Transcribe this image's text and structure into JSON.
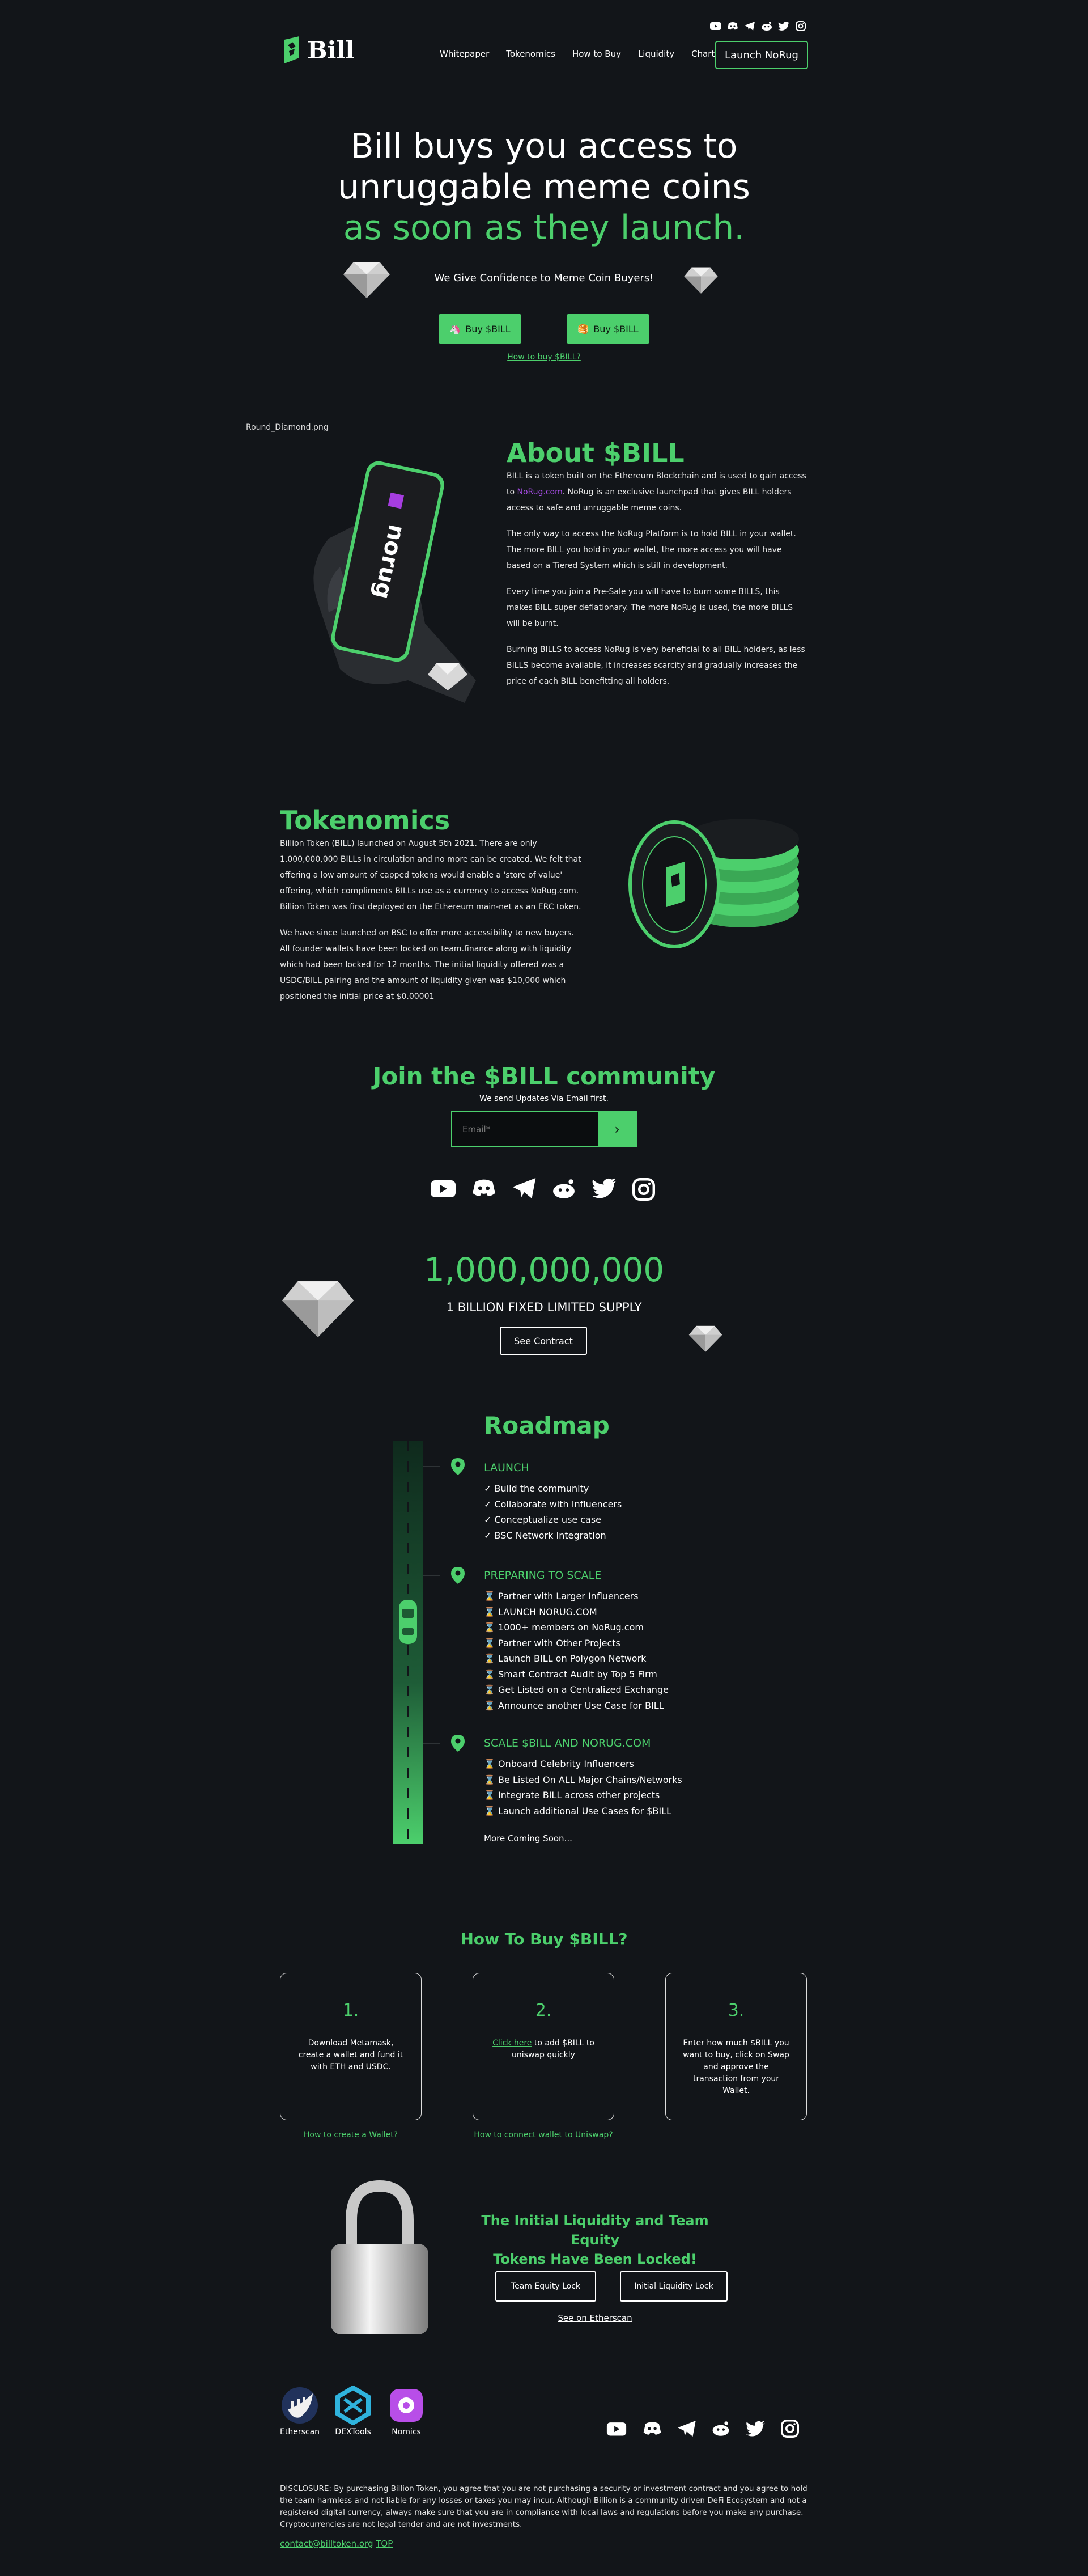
{
  "header": {
    "brand": "Bill",
    "nav": [
      "Whitepaper",
      "Tokenomics",
      "How to Buy",
      "Liquidity",
      "Chart"
    ],
    "launch_button": "Launch NoRug",
    "social_icons": [
      "youtube-icon",
      "discord-icon",
      "telegram-icon",
      "reddit-icon",
      "twitter-icon",
      "instagram-icon"
    ]
  },
  "hero": {
    "title_line1": "Bill buys you access to",
    "title_line2": "unruggable meme coins",
    "title_line3": "as soon as they launch.",
    "subtitle": "We Give Confidence to Meme Coin Buyers!",
    "buy_button_1": "Buy $BILL",
    "buy_button_2": "Buy $BILL",
    "how_link": "How to buy $BILL?"
  },
  "about": {
    "image_alt": "Round_Diamond.png",
    "phone_brand": "norug",
    "title": "About $BILL",
    "p1_before": "BILL is a token built on the Ethereum Blockchain and is used to gain access to",
    "p1_link": "NoRug.com",
    "p1_after": ". NoRug is an exclusive launchpad that gives BILL holders access to safe and unruggable meme coins.",
    "p2": "The only way to access the NoRug Platform is to hold BILL in your wallet. The more BILL you hold in your wallet, the more access you will have based on a Tiered System which is still in development.",
    "p3": "Every time you join a Pre-Sale you will have to burn some BILLS, this makes BILL super deflationary. The more NoRug is used, the more BILLS will be burnt.",
    "p4": "Burning BILLS to access NoRug is very beneficial to all BILL holders, as less BILLS become available, it increases scarcity and gradually increases the price of each BILL benefitting all holders."
  },
  "tokenomics": {
    "title": "Tokenomics",
    "p1": "Billion Token (BILL) launched on August 5th 2021. There are only 1,000,000,000 BILLs in circulation and no more can be created. We felt that offering a low amount of capped tokens would enable a 'store of value' offering, which compliments BILLs use as a currency to access NoRug.com. Billion Token was first deployed on the Ethereum main-net as an ERC token.",
    "p2": "We have since launched on BSC to offer more accessibility to new buyers. All founder wallets have been locked on team.finance along with liquidity which had been locked for 12 months. The initial liquidity offered was a USDC/BILL pairing and the amount of liquidity given was $10,000 which positioned the initial price at $0.00001"
  },
  "community": {
    "title": "Join the $BILL community",
    "subtitle": "We send Updates Via Email first.",
    "email_placeholder": "Email*",
    "submit_glyph": "›"
  },
  "supply": {
    "number": "1,000,000,000",
    "label": "1 BILLION FIXED LIMITED SUPPLY",
    "button": "See Contract"
  },
  "roadmap": {
    "title": "Roadmap",
    "phases": [
      {
        "name": "LAUNCH",
        "mark": "✓",
        "items": [
          "Build the community",
          "Collaborate with Influencers",
          "Conceptualize use case",
          "BSC Network Integration"
        ]
      },
      {
        "name": "PREPARING TO SCALE",
        "mark": "⌛",
        "items": [
          "Partner with Larger Influencers",
          "LAUNCH NORUG.COM",
          "1000+ members on NoRug.com",
          "Partner with Other Projects",
          "Launch BILL on Polygon Network",
          "Smart Contract Audit by Top 5 Firm",
          "Get Listed on a Centralized Exchange",
          "Announce another Use Case for BILL"
        ]
      },
      {
        "name": "SCALE $BILL AND NORUG.COM",
        "mark": "⌛",
        "items": [
          "Onboard Celebrity Influencers",
          "Be Listed On ALL Major Chains/Networks",
          "Integrate BILL across other projects",
          "Launch additional Use Cases for $BILL"
        ]
      }
    ],
    "more": "More Coming Soon..."
  },
  "howtobuy": {
    "title": "How To Buy $BILL?",
    "card1_num": "1.",
    "card1_text": "Download Metamask, create a wallet and fund it with ETH and USDC.",
    "card2_num": "2.",
    "card2_link": "Click here",
    "card2_text": " to add $BILL to uniswap quickly",
    "card3_num": "3.",
    "card3_text": "Enter how much $BILL you want to buy, click on Swap and approve the transaction from your Wallet.",
    "link1": "How to create a Wallet?",
    "link2": "How to connect wallet to Uniswap?"
  },
  "liquidity": {
    "title_line1": "The Initial Liquidity and Team Equity",
    "title_line2": "Tokens Have Been Locked!",
    "btn1": "Team Equity Lock",
    "btn2": "Initial Liquidity Lock",
    "link": "See on Etherscan"
  },
  "footer": {
    "partners": [
      "Etherscan",
      "DEXTools",
      "Nomics"
    ],
    "disclosure": "DISCLOSURE: By purchasing Billion Token, you agree that you are not purchasing a security or investment contract and you agree to hold the team harmless and not liable for any losses or taxes you may incur. Although Billion is a community driven DeFi Ecosystem and not a registered digital currency, always make sure that you are in compliance with local laws and regulations before you make any purchase. Cryptocurrencies are not legal tender and are not investments.",
    "contact": "contact@billtoken.org",
    "top_link": "TOP"
  },
  "colors": {
    "accent": "#4ccf6c",
    "background": "#121519"
  }
}
